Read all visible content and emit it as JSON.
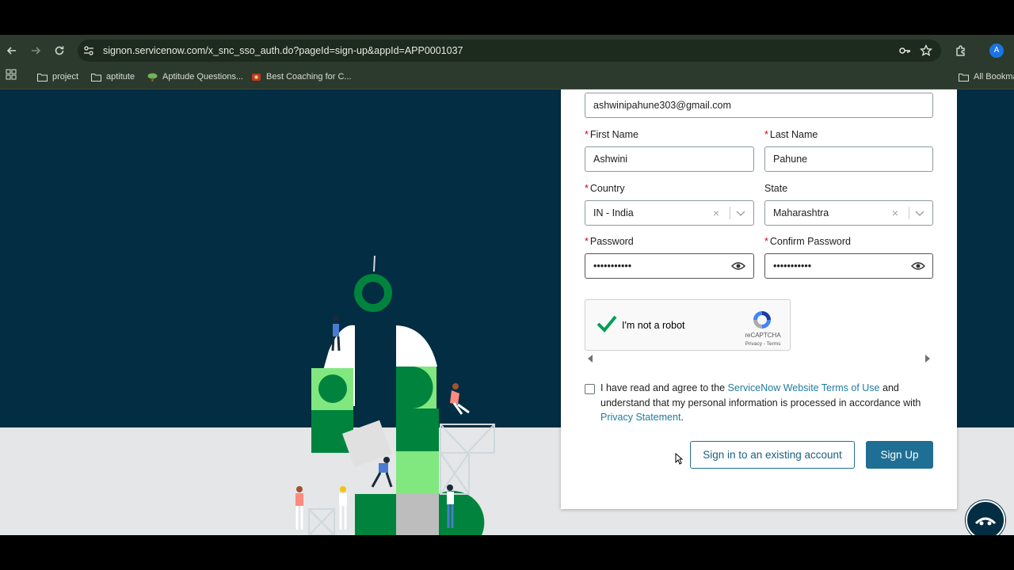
{
  "browser": {
    "url": "signon.servicenow.com/x_snc_sso_auth.do?pageId=sign-up&appId=APP0001037",
    "profile_initial": "A",
    "bookmarks": [
      {
        "label": "project",
        "icon": "folder-icon"
      },
      {
        "label": "aptitute",
        "icon": "folder-icon"
      },
      {
        "label": "Aptitude Questions...",
        "icon": "tree-icon"
      },
      {
        "label": "Best Coaching for C...",
        "icon": "site-icon"
      },
      {
        "label": "All Bookma",
        "icon": "folder-icon"
      }
    ]
  },
  "form": {
    "email_value": "ashwinipahune303@gmail.com",
    "first_name": {
      "label": "First Name",
      "value": "Ashwini",
      "required": "*"
    },
    "last_name": {
      "label": "Last Name",
      "value": "Pahune",
      "required": "*"
    },
    "country": {
      "label": "Country",
      "value": "IN - India",
      "required": "*"
    },
    "state": {
      "label": "State",
      "value": "Maharashtra"
    },
    "password": {
      "label": "Password",
      "value": "•••••••••••",
      "required": "*"
    },
    "confirm_password": {
      "label": "Confirm Password",
      "value": "•••••••••••",
      "required": "*"
    },
    "clear_glyph": "×"
  },
  "recaptcha": {
    "label": "I'm not a robot",
    "brand": "reCAPTCHA",
    "links": "Privacy - Terms",
    "checked": true
  },
  "terms": {
    "text_1": "I have read and agree to the ",
    "link_1": "ServiceNow Website Terms of Use",
    "text_2": " and understand that my personal information is processed in accordance with ",
    "link_2": "Privacy Statement",
    "text_3": "."
  },
  "buttons": {
    "sign_in": "Sign in to an existing account",
    "sign_up": "Sign Up"
  },
  "colors": {
    "brand_dark": "#032d42",
    "accent": "#1f6f94",
    "green": "#00843d",
    "light_green": "#81e77f"
  }
}
